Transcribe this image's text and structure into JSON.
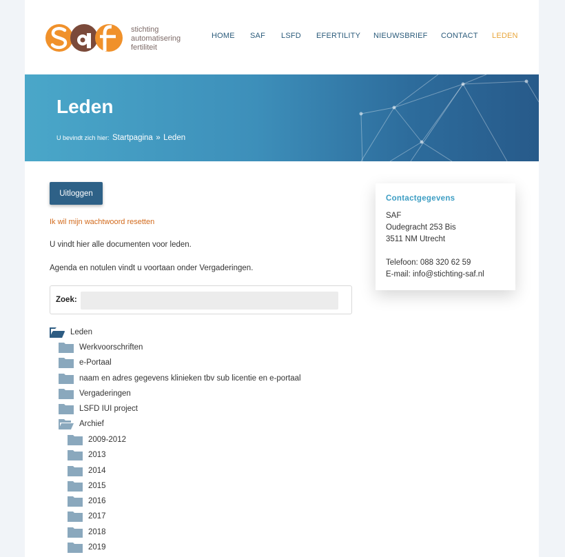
{
  "header": {
    "logo_text": [
      "stichting",
      "automatisering",
      "fertiliteit"
    ],
    "nav": [
      {
        "label": "HOME",
        "active": false
      },
      {
        "label": "SAF",
        "active": false
      },
      {
        "label": "LSFD",
        "active": false
      },
      {
        "label": "EFERTILITY",
        "active": false
      },
      {
        "label": "NIEUWSBRIEF",
        "active": false
      },
      {
        "label": "CONTACT",
        "active": false
      },
      {
        "label": "LEDEN",
        "active": true
      }
    ]
  },
  "banner": {
    "title": "Leden",
    "breadcrumb_prefix": "U bevindt zich hier:",
    "breadcrumb_home": "Startpagina",
    "breadcrumb_sep": "»",
    "breadcrumb_current": "Leden"
  },
  "main": {
    "logout_label": "Uitloggen",
    "reset_link": "Ik wil mijn wachtwoord resetten",
    "intro": "U vindt hier alle documenten voor leden.",
    "agenda_note": "Agenda en notulen vindt u voortaan onder Vergaderingen.",
    "search": {
      "label": "Zoek:",
      "value": "",
      "placeholder": ""
    },
    "tree": [
      {
        "label": "Leden",
        "level": 0,
        "open": true
      },
      {
        "label": "Werkvoorschriften",
        "level": 1,
        "open": false
      },
      {
        "label": "e-Portaal",
        "level": 1,
        "open": false
      },
      {
        "label": "naam en adres gegevens klinieken tbv sub licentie en e-portaal",
        "level": 1,
        "open": false
      },
      {
        "label": "Vergaderingen",
        "level": 1,
        "open": false
      },
      {
        "label": "LSFD IUI project",
        "level": 1,
        "open": false
      },
      {
        "label": "Archief",
        "level": 1,
        "open": true
      },
      {
        "label": "2009-2012",
        "level": 2,
        "open": false
      },
      {
        "label": "2013",
        "level": 2,
        "open": false
      },
      {
        "label": "2014",
        "level": 2,
        "open": false
      },
      {
        "label": "2015",
        "level": 2,
        "open": false
      },
      {
        "label": "2016",
        "level": 2,
        "open": false
      },
      {
        "label": "2017",
        "level": 2,
        "open": false
      },
      {
        "label": "2018",
        "level": 2,
        "open": false
      },
      {
        "label": "2019",
        "level": 2,
        "open": false
      }
    ]
  },
  "sidebar": {
    "title": "Contactgegevens",
    "lines": [
      "SAF",
      "Oudegracht 253 Bis",
      "3511 NM Utrecht",
      "",
      "Telefoon: 088 320 62 59",
      "E-mail: info@stichting-saf.nl"
    ]
  },
  "colors": {
    "brand_orange": "#f0912b",
    "brand_brown": "#7b4a3a",
    "nav_text": "#2a5a7a",
    "nav_active": "#e8a53a",
    "banner_start": "#4aa7c9",
    "banner_end": "#275a8a",
    "button_bg": "#2e6187",
    "link_orange": "#d26a1c",
    "accent_blue": "#3c9dc3",
    "folder_closed": "#8aa8bd",
    "folder_open_root": "#2d5c82"
  }
}
